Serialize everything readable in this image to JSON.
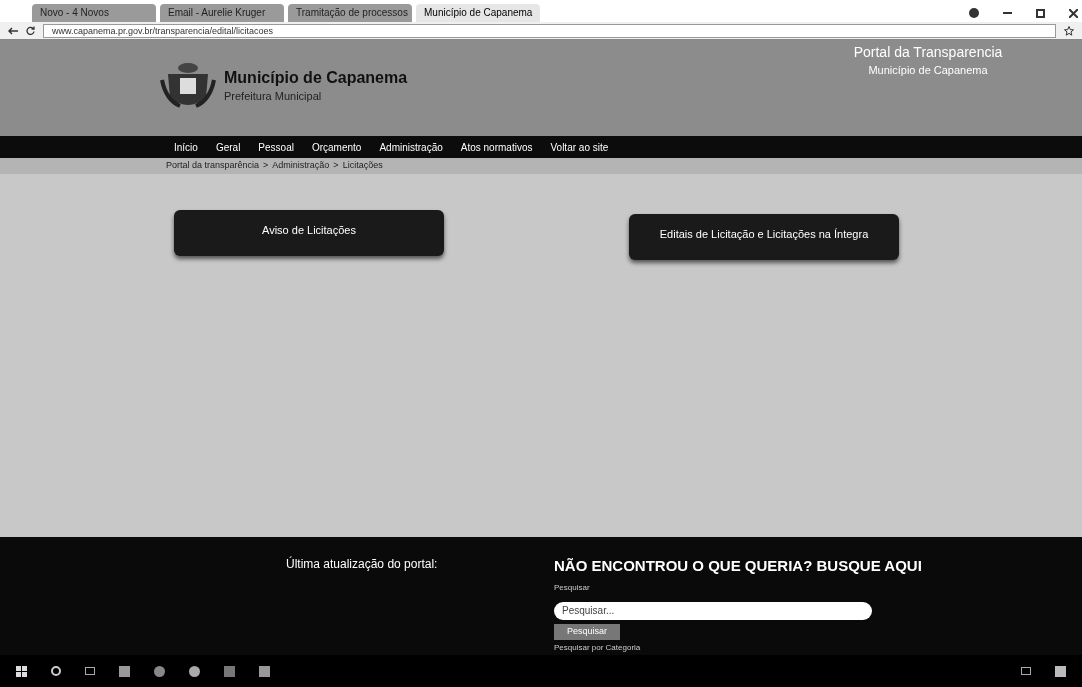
{
  "browser": {
    "tabs": [
      {
        "title": "Novo - 4 Novos",
        "selected": false
      },
      {
        "title": "Email - Aurelie Kruger",
        "selected": false
      },
      {
        "title": "Tramitação de processos",
        "selected": false
      },
      {
        "title": "Município de Capanema",
        "selected": true
      }
    ],
    "address": "www.capanema.pr.gov.br/transparencia/edital/licitacoes"
  },
  "header": {
    "title": "Município de Capanema",
    "subtitle": "Prefeitura Municipal",
    "portal_title": "Portal da Transparencia",
    "portal_subtitle": "Município de Capanema"
  },
  "nav": [
    "Início",
    "Geral",
    "Pessoal",
    "Orçamento",
    "Administração",
    "Atos normativos",
    "Voltar ao site"
  ],
  "breadcrumb": [
    "Portal da transparência",
    "Administração",
    "Licitações"
  ],
  "breadcrumb_separator": ">",
  "cards": [
    "Aviso de Licitações",
    "Editais de Licitação e Licitações na Íntegra"
  ],
  "footer": {
    "update_label": "Última atualização do portal:",
    "search_title": "NÃO ENCONTROU O QUE QUERIA? BUSQUE AQUI",
    "search_label": "Pesquisar",
    "search_placeholder": "Pesquisar...",
    "search_button": "Pesquisar",
    "category_link": "Pesquisar por Categoria"
  }
}
